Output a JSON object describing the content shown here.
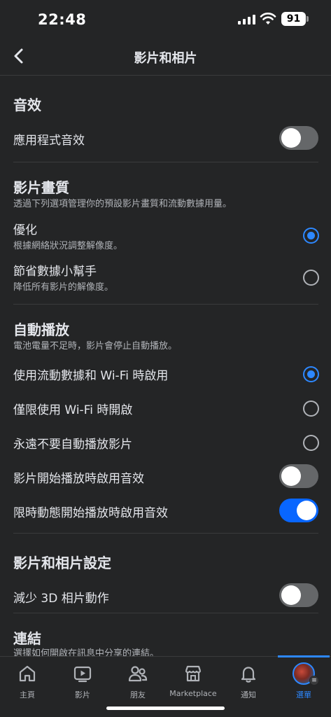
{
  "status_bar": {
    "time": "22:48",
    "battery": "91"
  },
  "header": {
    "title": "影片和相片"
  },
  "sections": {
    "sound": {
      "title": "音效",
      "app_sound_label": "應用程式音效",
      "app_sound_on": false
    },
    "video_quality": {
      "title": "影片畫質",
      "subtitle": "透過下列選項管理你的預設影片畫質和流動數據用量。",
      "options": [
        {
          "label": "優化",
          "sub": "根據網絡狀況調整解像度。",
          "selected": true
        },
        {
          "label": "節省數據小幫手",
          "sub": "降低所有影片的解像度。",
          "selected": false
        }
      ]
    },
    "autoplay": {
      "title": "自動播放",
      "subtitle": "電池電量不足時，影片會停止自動播放。",
      "options": [
        {
          "label": "使用流動數據和 Wi-Fi 時啟用",
          "selected": true
        },
        {
          "label": "僅限使用 Wi-Fi 時開啟",
          "selected": false
        },
        {
          "label": "永遠不要自動播放影片",
          "selected": false
        }
      ],
      "video_sound_label": "影片開始播放時啟用音效",
      "video_sound_on": false,
      "stories_sound_label": "限時動態開始播放時啟用音效",
      "stories_sound_on": true
    },
    "media_settings": {
      "title": "影片和相片設定",
      "reduce_3d_label": "減少 3D 相片動作",
      "reduce_3d_on": false
    },
    "links": {
      "title": "連結",
      "subtitle": "選擇如何開啟在訊息中分享的連結。"
    }
  },
  "tabbar": {
    "tabs": [
      {
        "label": "主頁",
        "icon": "home-icon"
      },
      {
        "label": "影片",
        "icon": "video-icon"
      },
      {
        "label": "朋友",
        "icon": "friends-icon"
      },
      {
        "label": "Marketplace",
        "icon": "marketplace-icon"
      },
      {
        "label": "通知",
        "icon": "bell-icon"
      },
      {
        "label": "選單",
        "icon": "avatar",
        "active": true
      }
    ]
  },
  "colors": {
    "accent": "#2d88ff",
    "background": "#242526",
    "toggle_on": "#0866ff",
    "toggle_off": "#656769"
  }
}
